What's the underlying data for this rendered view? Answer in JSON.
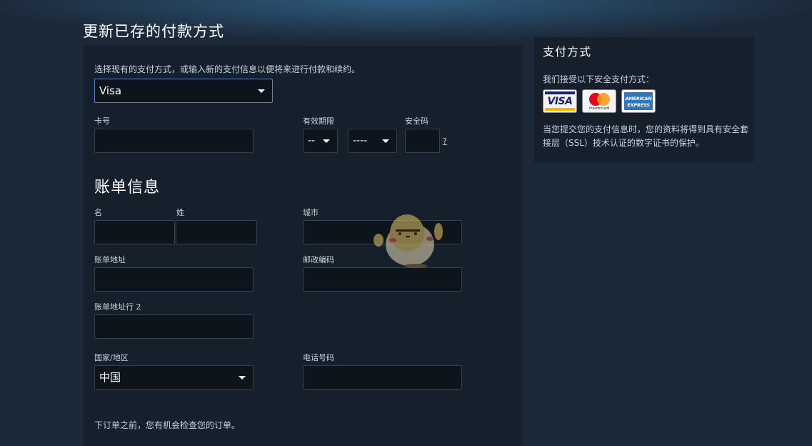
{
  "page": {
    "title": "更新已存的付款方式"
  },
  "form": {
    "intro": "选择现有的支付方式，或输入新的支付信息以便将来进行付款和续约。",
    "payment_method": {
      "selected": "Visa"
    },
    "card_number": {
      "label": "卡号",
      "value": ""
    },
    "expiration": {
      "label": "有效期限",
      "month_selected": "--",
      "year_selected": "----"
    },
    "security_code": {
      "label": "安全码",
      "value": "",
      "help": "?"
    },
    "billing": {
      "title": "账单信息",
      "first_name": {
        "label": "名",
        "value": ""
      },
      "last_name": {
        "label": "姓",
        "value": ""
      },
      "city": {
        "label": "城市",
        "value": ""
      },
      "address": {
        "label": "账单地址",
        "value": ""
      },
      "zip": {
        "label": "邮政编码",
        "value": ""
      },
      "address2": {
        "label": "账单地址行 2",
        "value": ""
      },
      "country": {
        "label": "国家/地区",
        "selected": "中国"
      },
      "phone": {
        "label": "电话号码",
        "value": ""
      }
    },
    "footer_note": "下订单之前，您有机会检查您的订单。"
  },
  "sidebar": {
    "title": "支付方式",
    "accept_text": "我们接受以下安全支付方式：",
    "cards": [
      {
        "name": "visa-logo",
        "text": "VISA"
      },
      {
        "name": "mastercard-logo",
        "text": "mastercard"
      },
      {
        "name": "amex-logo",
        "line1": "AMERICAN",
        "line2": "EXPRESS"
      }
    ],
    "security_text": "当您提交您的支付信息时，您的资料将得到具有安全套接层（SSL）技术认证的数字证书的保护。"
  },
  "colors": {
    "background": "#1b2838",
    "panel": "#16202d",
    "input_bg": "#0e141b",
    "focus_border": "#5a82c5",
    "text": "#c6d4df",
    "heading": "#ffffff"
  }
}
